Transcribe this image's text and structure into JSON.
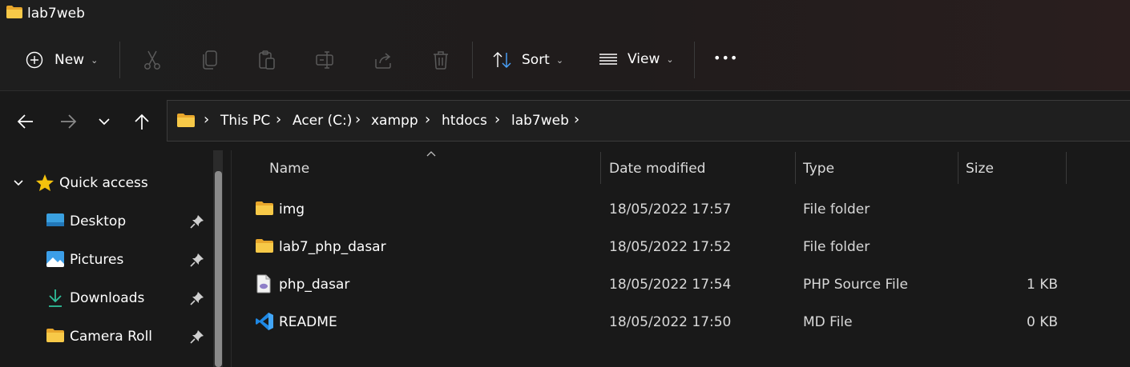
{
  "window": {
    "title": "lab7web"
  },
  "toolbar": {
    "new_label": "New",
    "sort_label": "Sort",
    "view_label": "View",
    "more_label": "•••",
    "accent": "#4aa3ff"
  },
  "address": {
    "breadcrumbs": [
      "This PC",
      "Acer (C:)",
      "xampp",
      "htdocs",
      "lab7web"
    ]
  },
  "nav": {
    "quick_access_label": "Quick access",
    "items": [
      {
        "label": "Desktop",
        "icon": "desktop-icon"
      },
      {
        "label": "Pictures",
        "icon": "pictures-icon"
      },
      {
        "label": "Downloads",
        "icon": "download-icon"
      },
      {
        "label": "Camera Roll",
        "icon": "folder-icon"
      }
    ]
  },
  "files": {
    "columns": {
      "name": "Name",
      "date": "Date modified",
      "type": "Type",
      "size": "Size"
    },
    "rows": [
      {
        "name": "img",
        "date": "18/05/2022 17:57",
        "type": "File folder",
        "size": "",
        "icon": "folder-icon"
      },
      {
        "name": "lab7_php_dasar",
        "date": "18/05/2022 17:52",
        "type": "File folder",
        "size": "",
        "icon": "folder-icon"
      },
      {
        "name": "php_dasar",
        "date": "18/05/2022 17:54",
        "type": "PHP Source File",
        "size": "1 KB",
        "icon": "php-file-icon"
      },
      {
        "name": "README",
        "date": "18/05/2022 17:50",
        "type": "MD File",
        "size": "0 KB",
        "icon": "vscode-icon"
      }
    ]
  },
  "colors": {
    "background": "#191919",
    "folder": "#f7c948",
    "star": "#f4c20d",
    "vscode": "#1e88e5"
  }
}
